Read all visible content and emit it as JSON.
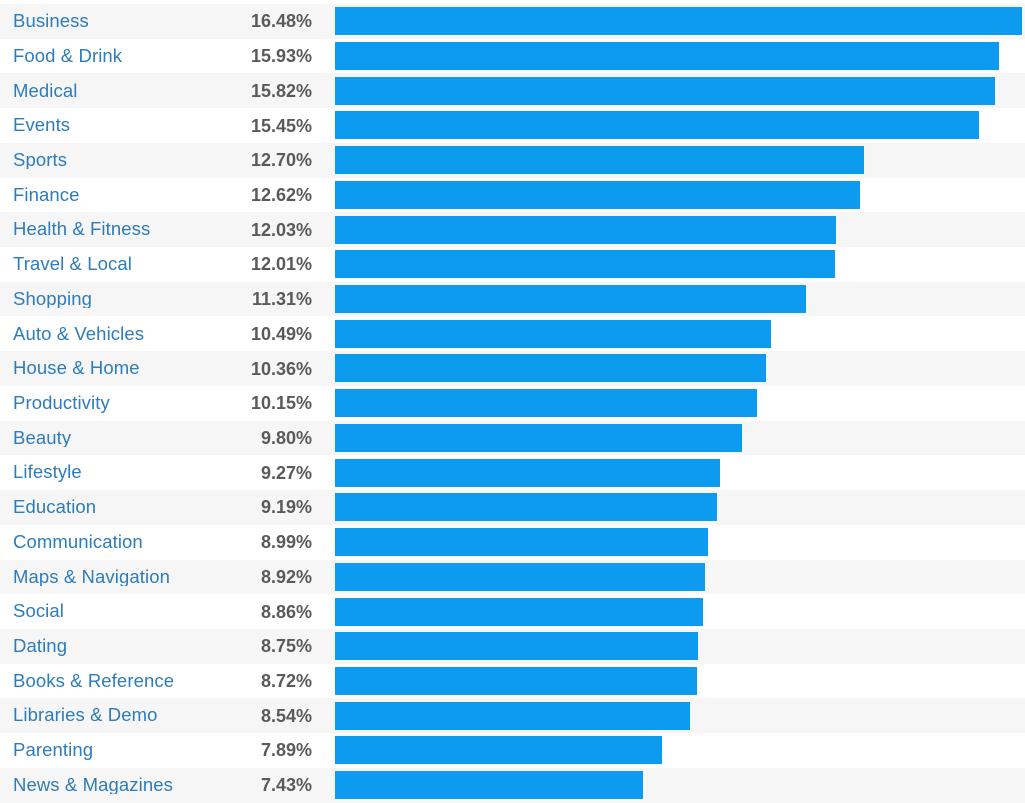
{
  "chart_data": {
    "type": "bar",
    "orientation": "horizontal",
    "title": "",
    "subtitle": "",
    "xlabel": "",
    "ylabel": "",
    "value_suffix": "%",
    "grid": false,
    "legend": null,
    "axis_visible": false,
    "xlim": [
      0,
      16.48
    ],
    "categories": [
      "Business",
      "Food & Drink",
      "Medical",
      "Events",
      "Sports",
      "Finance",
      "Health & Fitness",
      "Travel & Local",
      "Shopping",
      "Auto & Vehicles",
      "House & Home",
      "Productivity",
      "Beauty",
      "Lifestyle",
      "Education",
      "Communication",
      "Maps & Navigation",
      "Social",
      "Dating",
      "Books & Reference",
      "Libraries & Demo",
      "Parenting",
      "News & Magazines"
    ],
    "values": [
      16.48,
      15.93,
      15.82,
      15.45,
      12.7,
      12.62,
      12.03,
      12.01,
      11.31,
      10.49,
      10.36,
      10.15,
      9.8,
      9.27,
      9.19,
      8.99,
      8.92,
      8.86,
      8.75,
      8.72,
      8.54,
      7.89,
      7.43
    ],
    "value_labels": [
      "16.48%",
      "15.93%",
      "15.82%",
      "15.45%",
      "12.70%",
      "12.62%",
      "12.03%",
      "12.01%",
      "11.31%",
      "10.49%",
      "10.36%",
      "10.15%",
      "9.80%",
      "9.27%",
      "9.19%",
      "8.99%",
      "8.92%",
      "8.86%",
      "8.75%",
      "8.72%",
      "8.54%",
      "7.89%",
      "7.43%"
    ]
  },
  "colors": {
    "bar": "#0d9bf0",
    "label_text": "#2d7cbc",
    "value_text": "#5a5a5a",
    "row_alt_background": "#f6f6f6",
    "row_background": "#ffffff"
  }
}
